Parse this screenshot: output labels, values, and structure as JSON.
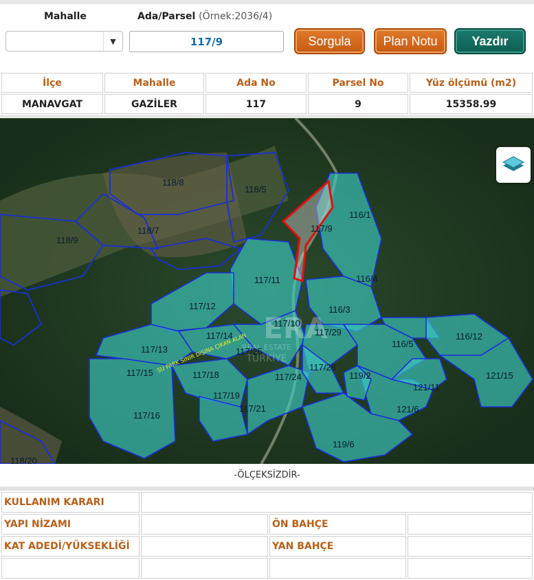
{
  "search": {
    "mahalle_label": "Mahalle",
    "ada_parsel_label": "Ada/Parsel",
    "ada_parsel_hint": "(Örnek:2036/4)",
    "mahalle_value": "",
    "ada_parsel_value": "117/9"
  },
  "buttons": {
    "sorgula": "Sorgula",
    "plan_notu": "Plan Notu",
    "yazdir": "Yazdır"
  },
  "parcel_table": {
    "headers": [
      "İlçe",
      "Mahalle",
      "Ada No",
      "Parsel No",
      "Yüz ölçümü (m2)"
    ],
    "values": [
      "MANAVGAT",
      "GAZİLER",
      "117",
      "9",
      "15358.99"
    ]
  },
  "map": {
    "parcel_labels": [
      "118/8",
      "118/5",
      "118/7",
      "118/9",
      "116/1",
      "117/9",
      "117/11",
      "116/4",
      "117/12",
      "116/3",
      "117/10",
      "117/14",
      "117/29",
      "116/5",
      "116/12",
      "117/13",
      "117/25",
      "117/15",
      "117/18",
      "117/26",
      "117/24",
      "119/2",
      "121/11",
      "121/15",
      "117/19",
      "117/21",
      "121/6",
      "117/16",
      "119/6",
      "118/20"
    ],
    "boundary_text": "SU PARK SINIR DIŞINA ÇIKAN ALAN",
    "watermark_title": "ERA",
    "watermark_sub": "REAL ESTATE",
    "watermark_brand": "TÜRKİYE",
    "colors": {
      "parcel_fill": "#3cc9c0",
      "parcel_line": "#1a2fd6",
      "selected_line": "#e01010",
      "forest": "#1f3a22"
    }
  },
  "scale_note": "-ÖLÇEKSİZDİR-",
  "plan_table": {
    "kullanim_karari": "KULLANIM KARARI",
    "yapi_nizami": "YAPI NİZAMI",
    "on_bahce": "ÖN BAHÇE",
    "kat_adedi": "KAT ADEDİ/YÜKSEKLİĞİ",
    "yan_bahce": "YAN BAHÇE"
  }
}
